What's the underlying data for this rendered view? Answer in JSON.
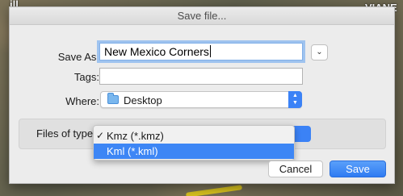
{
  "window": {
    "title": "Save file..."
  },
  "background": {
    "map_labels": [
      "ill",
      "VIANE"
    ]
  },
  "form": {
    "save_as_label": "Save As:",
    "save_as_value": "New Mexico Corners",
    "tags_label": "Tags:",
    "tags_value": "",
    "where_label": "Where:",
    "where_value": "Desktop",
    "where_icon": "folder-icon"
  },
  "format": {
    "label": "Files of type",
    "selected": "Kmz (*.kmz)",
    "options": [
      {
        "label": "Kmz (*.kmz)",
        "checked": true,
        "highlighted": false
      },
      {
        "label": "Kml (*.kml)",
        "checked": false,
        "highlighted": true
      }
    ]
  },
  "buttons": {
    "cancel": "Cancel",
    "save": "Save"
  },
  "icons": {
    "expand": "chevron-down-icon",
    "check": "checkmark-icon",
    "stepper": "up-down-arrows-icon"
  },
  "colors": {
    "accent": "#3b82f6",
    "dialog_bg": "#ececec",
    "focus_ring": "#9fc3ef"
  }
}
